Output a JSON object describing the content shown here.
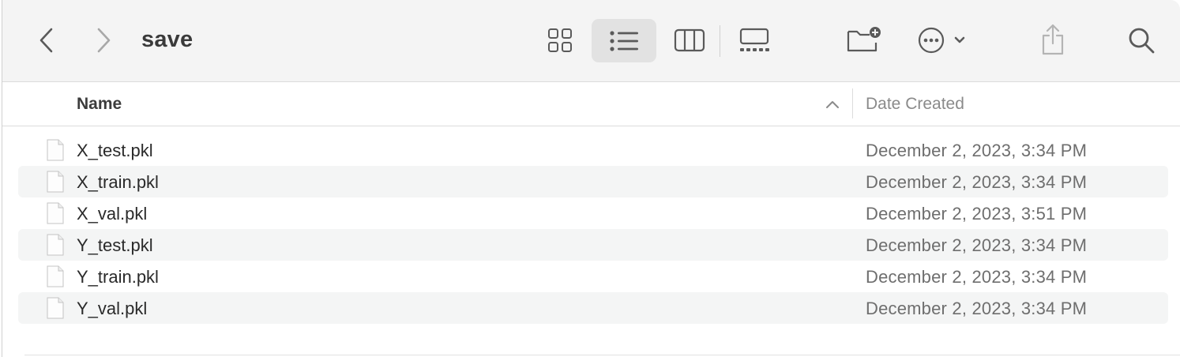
{
  "toolbar": {
    "title": "save",
    "icons": {
      "back": "chevron-left-icon",
      "forward": "chevron-right-icon",
      "grid_view": "grid-view-icon",
      "list_view": "list-view-icon",
      "column_view": "column-view-icon",
      "gallery_view": "gallery-view-icon",
      "new_folder": "folder-badge-plus-icon",
      "more": "ellipsis-circle-icon",
      "share": "share-icon",
      "search": "magnifying-glass-icon"
    },
    "selected_view": "list"
  },
  "columns": {
    "name": "Name",
    "date_created": "Date Created",
    "sort": "ascending"
  },
  "files": [
    {
      "name": "X_test.pkl",
      "date": "December 2, 2023, 3:34 PM"
    },
    {
      "name": "X_train.pkl",
      "date": "December 2, 2023, 3:34 PM"
    },
    {
      "name": "X_val.pkl",
      "date": "December 2, 2023, 3:51 PM"
    },
    {
      "name": "Y_test.pkl",
      "date": "December 2, 2023, 3:34 PM"
    },
    {
      "name": "Y_train.pkl",
      "date": "December 2, 2023, 3:34 PM"
    },
    {
      "name": "Y_val.pkl",
      "date": "December 2, 2023, 3:34 PM"
    }
  ],
  "colors": {
    "toolbar_bg": "#f4f4f4",
    "selected_view_bg": "#e2e2e2",
    "row_alt_bg": "#f4f5f5",
    "icon_gray": "#5a5a5a"
  }
}
